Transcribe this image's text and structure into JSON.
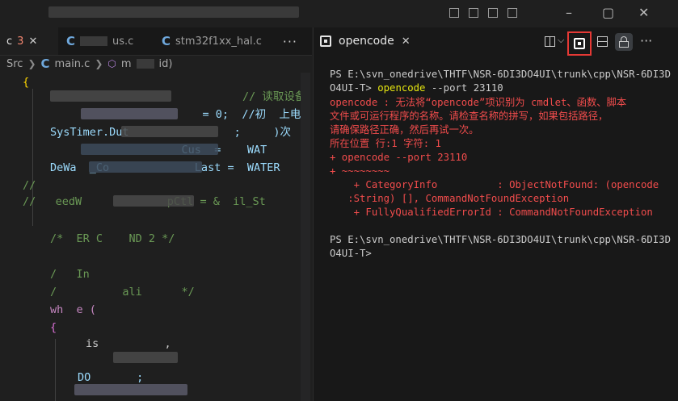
{
  "colors": {
    "accent_red": "#e53935",
    "terminal_error": "#f14c4c",
    "command": "#e5e510"
  },
  "editor": {
    "tabs": [
      {
        "label": "c",
        "badge": "3",
        "icon": "c-file-icon"
      },
      {
        "label": "us.c",
        "icon": "c-file-icon"
      },
      {
        "label": "stm32f1xx_hal.c",
        "icon": "c-file-icon"
      }
    ],
    "more_label": "···",
    "breadcrumb": {
      "folder": "Src",
      "file": "main.c",
      "symbol": "m",
      "symbol_suffix": "id)"
    },
    "code_lines": [
      {
        "text": "{"
      },
      {
        "text": "// 读取设备"
      },
      {
        "text": "                    = 0;  //初  上电"
      },
      {
        "text": "SysTimer.Dut                ;     )次"
      },
      {
        "text": "                    Cus  =    WAT"
      },
      {
        "text": "DeWa  _Co             Last =  WATER"
      },
      {
        "text": "//"
      },
      {
        "text": "//   eedW             pCtl = &  il_St"
      },
      {
        "text": "/*  ER C    ND 2 */"
      },
      {
        "text": "/   In"
      },
      {
        "text": "/          ali      */"
      },
      {
        "text": "wh  e ("
      },
      {
        "text": "{"
      },
      {
        "text": "is          ,"
      },
      {
        "text": ""
      },
      {
        "text": "DO       ;"
      }
    ]
  },
  "terminal": {
    "tab_label": "opencode",
    "tab_close": "✕",
    "actions": [
      "split-terminal-icon",
      "chevron-down-icon",
      "maximize-panel-icon",
      "panel-layout-icon",
      "lock-icon",
      "more-icon"
    ],
    "lines": [
      {
        "text": "PS E:\\svn_onedrive\\THTF\\NSR-6DI3DO4UI\\trunk\\cpp\\NSR-6DI3D",
        "color": "white"
      },
      {
        "text": "O4UI-T> ",
        "color": "white",
        "cmd": "opencode",
        "args": " --port 23110"
      },
      {
        "text": "opencode : 无法将“opencode”项识别为 cmdlet、函数、脚本",
        "color": "red"
      },
      {
        "text": "文件或可运行程序的名称。请检查名称的拼写，如果包括路径，",
        "color": "red"
      },
      {
        "text": "请确保路径正确，然后再试一次。",
        "color": "red"
      },
      {
        "text": "所在位置 行:1 字符: 1",
        "color": "red"
      },
      {
        "text": "+ opencode --port 23110",
        "color": "red"
      },
      {
        "text": "+ ~~~~~~~~",
        "color": "red"
      },
      {
        "text": "    + CategoryInfo          : ObjectNotFound: (opencode",
        "color": "red"
      },
      {
        "text": "   :String) [], CommandNotFoundException",
        "color": "red"
      },
      {
        "text": "    + FullyQualifiedErrorId : CommandNotFoundException",
        "color": "red"
      },
      {
        "text": "",
        "color": "white"
      },
      {
        "text": "PS E:\\svn_onedrive\\THTF\\NSR-6DI3DO4UI\\trunk\\cpp\\NSR-6DI3D",
        "color": "white"
      },
      {
        "text": "O4UI-T>",
        "color": "white"
      }
    ]
  }
}
